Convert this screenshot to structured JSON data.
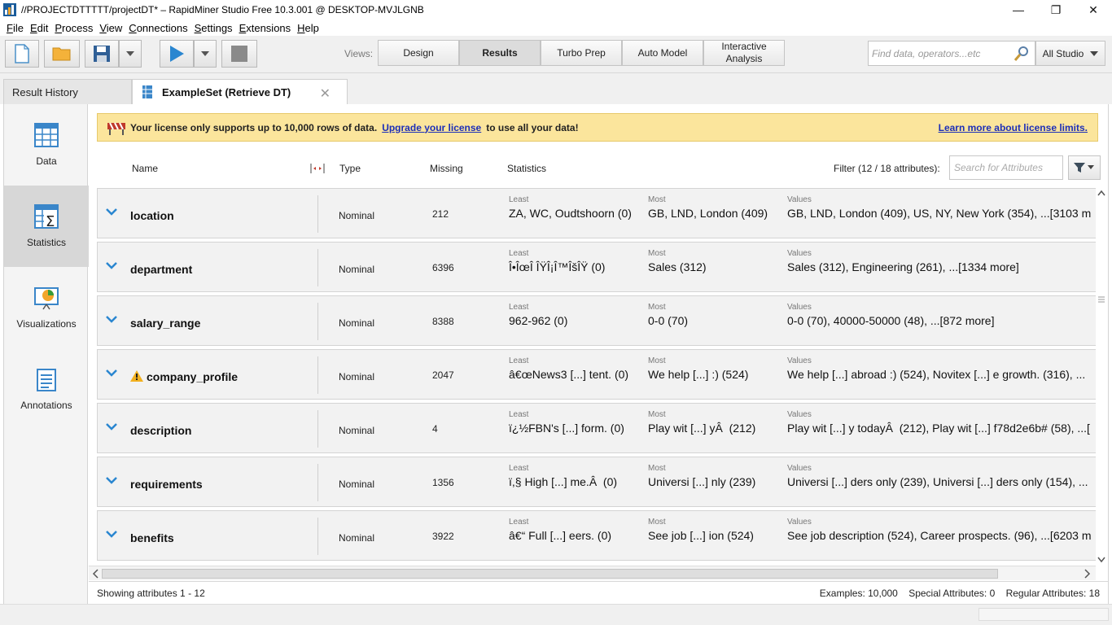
{
  "window": {
    "title": "//PROJECTDTTTTT/projectDT* – RapidMiner Studio Free 10.3.001 @ DESKTOP-MVJLGNB"
  },
  "menu": [
    "File",
    "Edit",
    "Process",
    "View",
    "Connections",
    "Settings",
    "Extensions",
    "Help"
  ],
  "toolbar": {
    "views_label": "Views:",
    "views": [
      "Design",
      "Results",
      "Turbo Prep",
      "Auto Model",
      "Interactive Analysis"
    ],
    "active_view": "Results",
    "search_placeholder": "Find data, operators...etc",
    "scope": "All Studio"
  },
  "tabs": {
    "history": "Result History",
    "active": "ExampleSet (Retrieve DT)"
  },
  "leftnav": [
    {
      "label": "Data",
      "icon": "table-icon"
    },
    {
      "label": "Statistics",
      "icon": "statistics-icon"
    },
    {
      "label": "Visualizations",
      "icon": "visualization-icon"
    },
    {
      "label": "Annotations",
      "icon": "annotations-icon"
    }
  ],
  "license": {
    "message": "Your license only supports up to 10,000 rows of data.",
    "upgrade_link": "Upgrade your license",
    "suffix": "to use all your data!",
    "learn_link": "Learn more about license limits."
  },
  "columns": {
    "name": "Name",
    "type": "Type",
    "missing": "Missing",
    "statistics": "Statistics",
    "filter_label": "Filter (12 / 18 attributes):",
    "filter_placeholder": "Search for Attributes"
  },
  "stat_labels": {
    "least": "Least",
    "most": "Most",
    "values": "Values"
  },
  "attributes": [
    {
      "name": "location",
      "warning": false,
      "type": "Nominal",
      "missing": "212",
      "least": "ZA, WC, Oudtshoorn (0)",
      "most": "GB, LND, London (409)",
      "values": "GB, LND, London (409), US, NY, New York (354), ...[3103 m"
    },
    {
      "name": "department",
      "warning": false,
      "type": "Nominal",
      "missing": "6396",
      "least": "Î•ÎœÎ ÎŸÎ¡Î™ÎšÎŸ (0)",
      "most": "Sales (312)",
      "values": "Sales (312), Engineering (261), ...[1334 more]"
    },
    {
      "name": "salary_range",
      "warning": false,
      "type": "Nominal",
      "missing": "8388",
      "least": "962-962 (0)",
      "most": "0-0 (70)",
      "values": "0-0 (70), 40000-50000 (48), ...[872 more]"
    },
    {
      "name": "company_profile",
      "warning": true,
      "type": "Nominal",
      "missing": "2047",
      "least": "â€œNews3 [...] tent. (0)",
      "most": "We help  [...]  :) (524)",
      "values": "We help  [...] abroad :) (524), Novitex  [...] e growth. (316), ..."
    },
    {
      "name": "description",
      "warning": false,
      "type": "Nominal",
      "missing": "4",
      "least": "ï¿½FBN's [...] form. (0)",
      "most": "Play wit [...] yÂ  (212)",
      "values": "Play wit [...] y todayÂ  (212), Play wit [...] f78d2e6b# (58), ...["
    },
    {
      "name": "requirements",
      "warning": false,
      "type": "Nominal",
      "missing": "1356",
      "least": "ï,§ High [...] me.Â  (0)",
      "most": "Universi [...] nly (239)",
      "values": "Universi [...] ders only (239), Universi [...] ders only (154), ..."
    },
    {
      "name": "benefits",
      "warning": false,
      "type": "Nominal",
      "missing": "3922",
      "least": "â€“ Full [...] eers. (0)",
      "most": "See job  [...] ion (524)",
      "values": "See job description (524), Career prospects. (96), ...[6203 m"
    }
  ],
  "footer": {
    "showing": "Showing attributes 1 - 12",
    "examples": "Examples: 10,000",
    "special": "Special Attributes: 0",
    "regular": "Regular Attributes: 18"
  }
}
